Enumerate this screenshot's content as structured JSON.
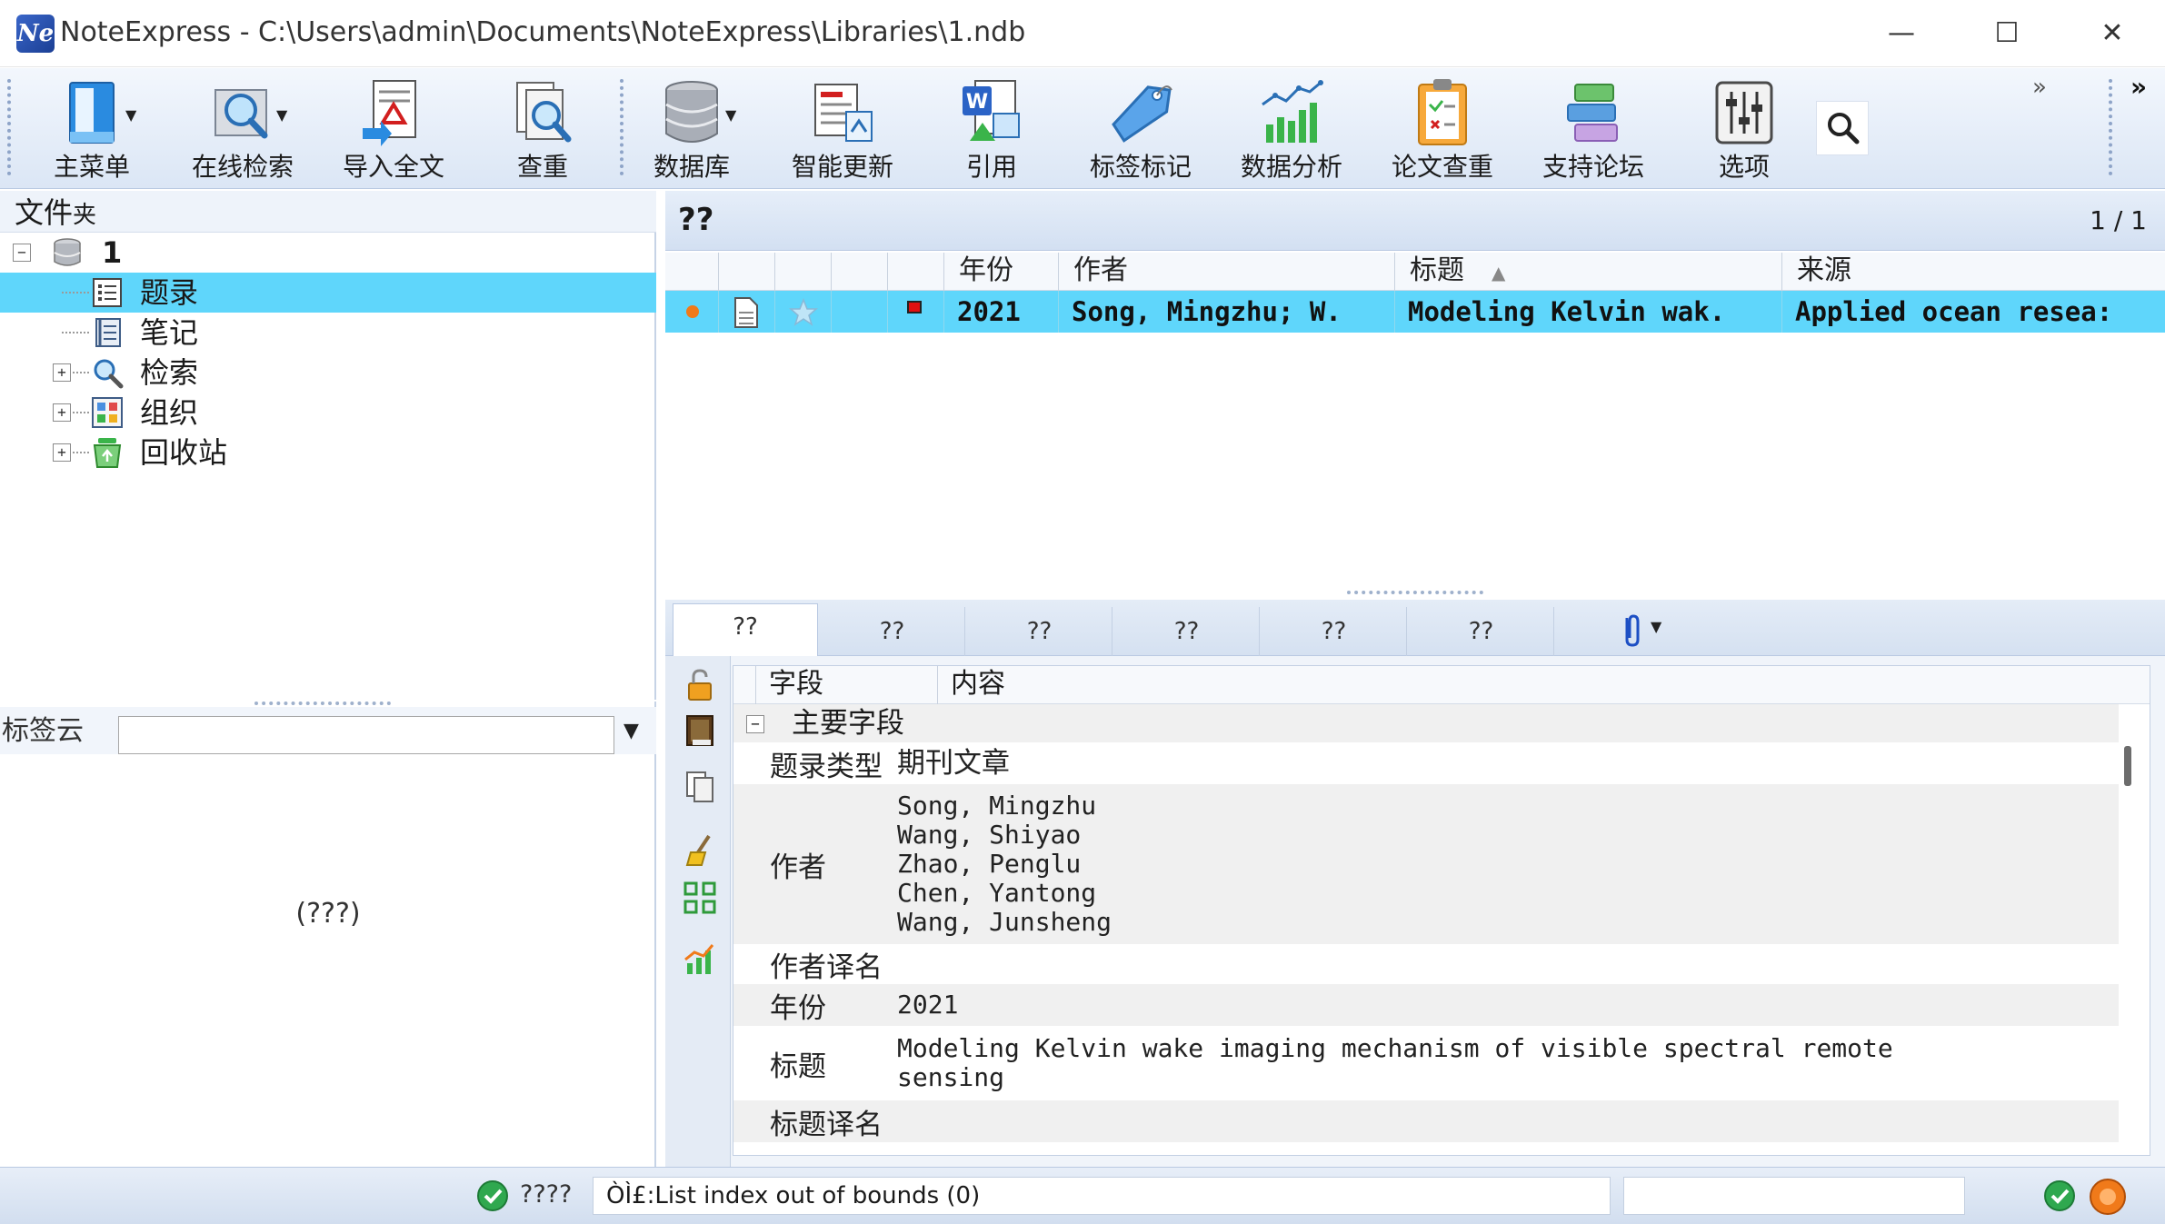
{
  "window": {
    "logo_text": "Ne",
    "title": "NoteExpress - C:\\Users\\admin\\Documents\\NoteExpress\\Libraries\\1.ndb",
    "minimize": "—",
    "maximize": "☐",
    "close": "✕"
  },
  "toolbar": {
    "buttons": [
      {
        "label": "主菜单"
      },
      {
        "label": "在线检索"
      },
      {
        "label": "导入全文"
      },
      {
        "label": "查重"
      },
      {
        "label": "数据库"
      },
      {
        "label": "智能更新"
      },
      {
        "label": "引用"
      },
      {
        "label": "标签标记"
      },
      {
        "label": "数据分析"
      },
      {
        "label": "论文查重"
      },
      {
        "label": "支持论坛"
      },
      {
        "label": "选项"
      }
    ],
    "overflow_1": "»",
    "overflow_2": "»"
  },
  "folders": {
    "title": "文件",
    "title_suffix": "夹",
    "tree": [
      {
        "label": "1",
        "expander": "−"
      },
      {
        "label": "题录"
      },
      {
        "label": "笔记"
      },
      {
        "label": "检索",
        "expander": "+"
      },
      {
        "label": "组织",
        "expander": "+"
      },
      {
        "label": "回收站",
        "expander": "+"
      }
    ]
  },
  "tagcloud": {
    "label": "标签云",
    "input_value": "",
    "dropdown": "▼",
    "empty_text": "(???)"
  },
  "reflist": {
    "title": "??",
    "page": "1 / 1",
    "columns": {
      "year": "年份",
      "author": "作者",
      "title": "标题",
      "source": "来源"
    },
    "sort_indicator": "▲",
    "rows": [
      {
        "year": "2021",
        "author": "Song, Mingzhu; W.",
        "title": "Modeling Kelvin wak.",
        "source": "Applied ocean resea:"
      }
    ]
  },
  "detail": {
    "tabs": [
      "??",
      "??",
      "??",
      "??",
      "??",
      "??"
    ],
    "attach_caret": "▼",
    "columns": {
      "field": "字段",
      "content": "内容"
    },
    "group": {
      "expander": "−",
      "label": "主要字段"
    },
    "fields": [
      {
        "name": "题录类型",
        "value": "期刊文章"
      },
      {
        "name": "作者",
        "value": "Song, Mingzhu\nWang, Shiyao\nZhao, Penglu\nChen, Yantong\nWang, Junsheng"
      },
      {
        "name": "作者译名",
        "value": ""
      },
      {
        "name": "年份",
        "value": "2021"
      },
      {
        "name": "标题",
        "value": "Modeling Kelvin wake imaging mechanism of visible spectral remote\nsensing"
      },
      {
        "name": "标题译名",
        "value": ""
      }
    ]
  },
  "status": {
    "text_1": "????",
    "message": "ÒÌ£:List index out of bounds (0)"
  },
  "colors": {
    "selection": "#5fd6fb",
    "toolbar_top": "#f3f7fd",
    "toolbar_bottom": "#dbe6f5",
    "status_ok": "#2fa84f",
    "status_orange": "#f07a1a"
  }
}
